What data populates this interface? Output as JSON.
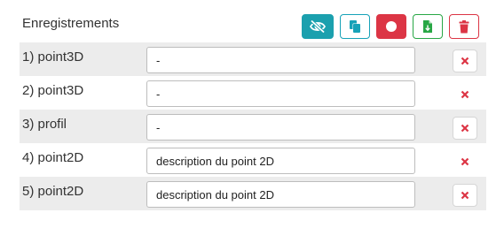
{
  "header": {
    "title": "Enregistrements"
  },
  "toolbar": {
    "hide_icon": "eye-slash-icon",
    "copy_icon": "copy-icon",
    "record_icon": "record-icon",
    "export_icon": "file-export-icon",
    "delete_icon": "trash-icon",
    "colors": {
      "info": "#1ba0ae",
      "danger": "#dc3545",
      "success": "#28a745"
    }
  },
  "records": [
    {
      "label": "1) point3D",
      "value": "-"
    },
    {
      "label": "2) point3D",
      "value": "-"
    },
    {
      "label": "3) profil",
      "value": "-"
    },
    {
      "label": "4) point2D",
      "value": "description du point 2D"
    },
    {
      "label": "5) point2D",
      "value": "description du point 2D"
    }
  ],
  "row_delete_icon": "close-icon"
}
